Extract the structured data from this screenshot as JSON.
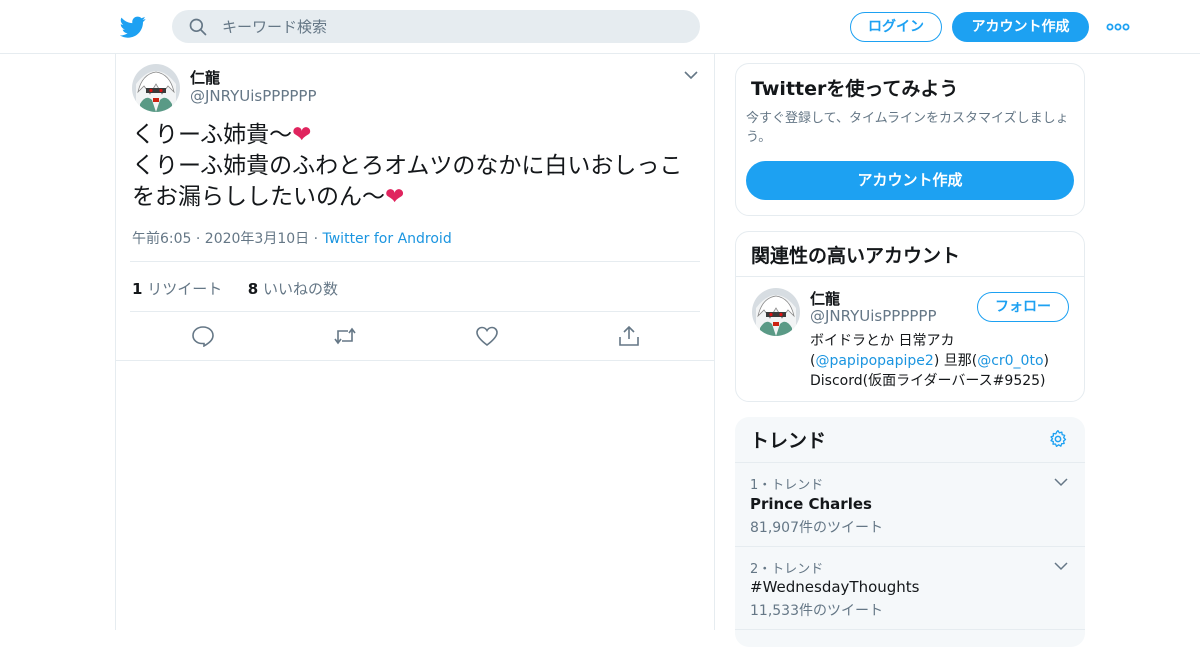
{
  "header": {
    "search_placeholder": "キーワード検索",
    "login_label": "ログイン",
    "signup_label": "アカウント作成"
  },
  "tweet": {
    "name": "仁龍",
    "handle": "@JNRYUisPPPPPP",
    "line1": "くりーふ姉貴～",
    "line2": "くりーふ姉貴のふわとろオムツのなかに白いおしっこをお漏らししたいのん～",
    "time": "午前6:05 · 2020年3月10日 · ",
    "source": "Twitter for Android",
    "retweets_count": "1",
    "retweets_label": "リツイート",
    "likes_count": "8",
    "likes_label": "いいねの数"
  },
  "signup_card": {
    "title": "Twitterを使ってみよう",
    "desc": "今すぐ登録して、タイムラインをカスタマイズしましょう。",
    "button": "アカウント作成"
  },
  "related_card": {
    "title": "関連性の高いアカウント",
    "name": "仁龍",
    "handle": "@JNRYUisPPPPPP",
    "follow_label": "フォロー",
    "bio_line1": "ボイドラとか 日常アカ",
    "bio_open": "(",
    "bio_link1": "@papipopapipe2",
    "bio_mid": ") 旦那(",
    "bio_link2": "@cr0_0to",
    "bio_close": ")",
    "bio_line3": "Discord(仮面ライダーバース#9525)"
  },
  "trends_card": {
    "title": "トレンド",
    "items": [
      {
        "meta": "1・トレンド",
        "name": "Prince Charles",
        "count": "81,907件のツイート"
      },
      {
        "meta": "2・トレンド",
        "name": "#WednesdayThoughts",
        "count": "11,533件のツイート"
      }
    ]
  },
  "colors": {
    "brand": "#1da1f2",
    "link": "#1b95e0",
    "heart": "#e0245e"
  }
}
